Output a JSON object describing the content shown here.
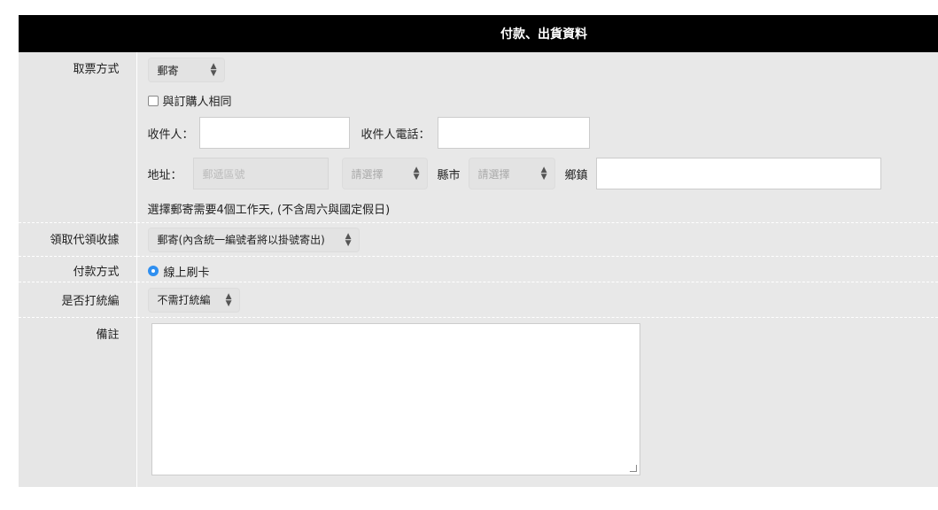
{
  "section_title": "付款、出貨資料",
  "fields": {
    "ticket_method": {
      "label": "取票方式",
      "selected": "郵寄",
      "same_as_buyer": "與訂購人相同",
      "recipient_label": "收件人：",
      "recipient_phone_label": "收件人電話：",
      "address_label": "地址：",
      "zip_placeholder": "郵遞區號",
      "county_selected": "請選擇",
      "county_suffix": "縣市",
      "town_selected": "請選擇",
      "town_suffix": "鄉鎮",
      "note": "選擇郵寄需要4個工作天, (不含周六與國定假日)"
    },
    "receipt": {
      "label": "領取代領收據",
      "selected": "郵寄(內含統一編號者將以掛號寄出)"
    },
    "payment": {
      "label": "付款方式",
      "option": "線上刷卡"
    },
    "tax_id": {
      "label": "是否打統編",
      "selected": "不需打統編"
    },
    "remarks": {
      "label": "備註"
    }
  }
}
